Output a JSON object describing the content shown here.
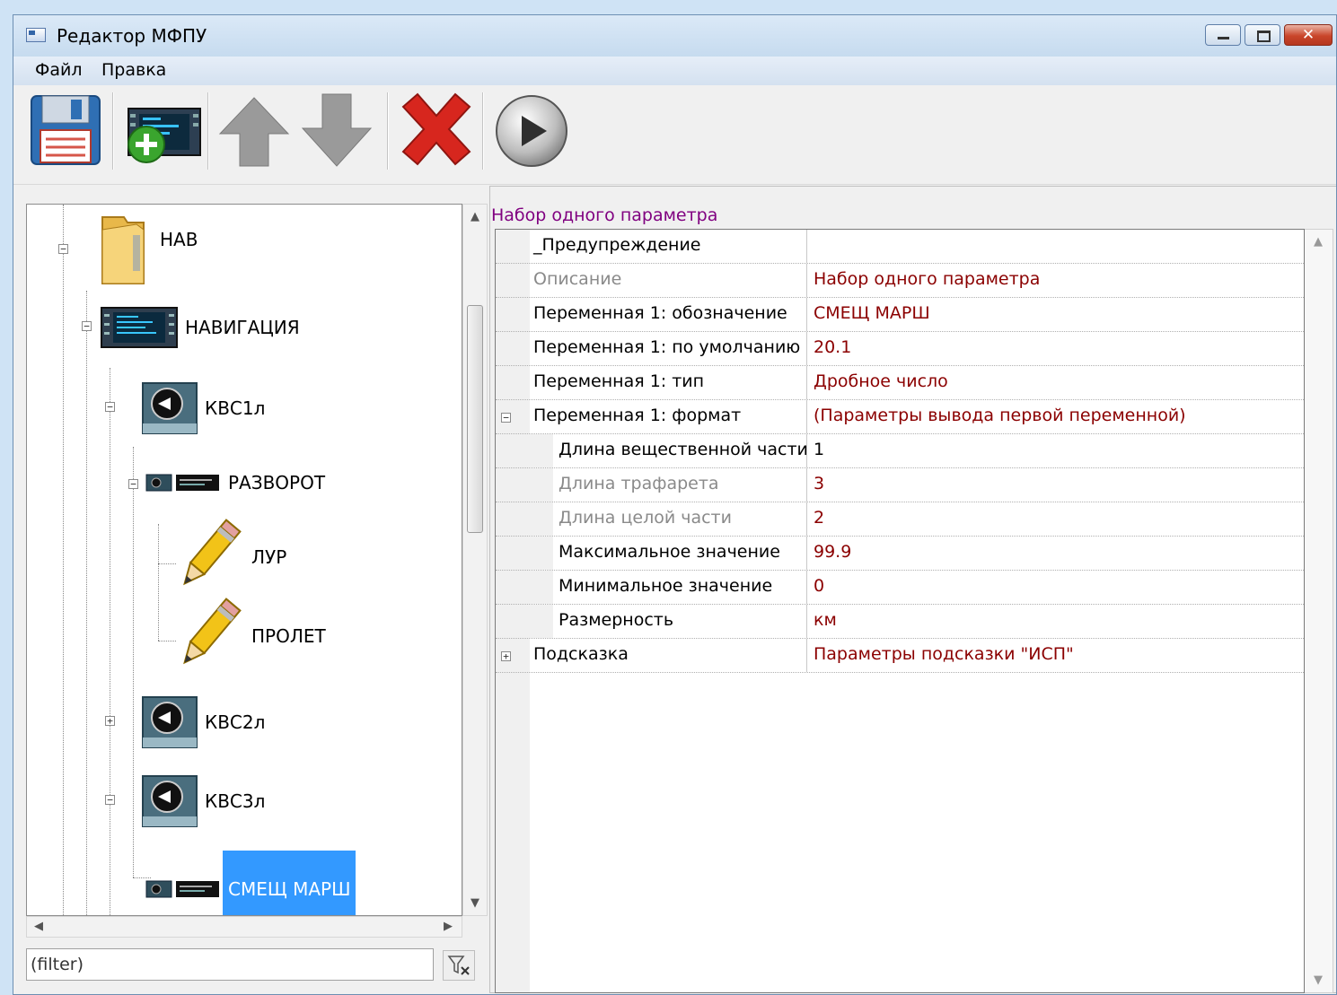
{
  "window": {
    "title": "Редактор МФПУ"
  },
  "menu": {
    "file": "Файл",
    "edit": "Правка"
  },
  "toolbar": {
    "buttons": [
      "save-icon",
      "add-panel-icon",
      "arrow-up-icon",
      "arrow-down-icon",
      "delete-icon",
      "play-icon"
    ]
  },
  "tree": {
    "nodes": [
      {
        "label": "НАВ",
        "icon": "folder-icon",
        "expanded": true
      },
      {
        "label": "НАВИГАЦИЯ",
        "icon": "panel-icon",
        "expanded": true
      },
      {
        "label": "КВС1л",
        "icon": "knob-icon",
        "expanded": true
      },
      {
        "label": "РАЗВОРОТ",
        "icon": "device-icon",
        "expanded": true
      },
      {
        "label": "ЛУР",
        "icon": "pencil-icon"
      },
      {
        "label": "ПРОЛЕТ",
        "icon": "pencil-icon"
      },
      {
        "label": "КВС2л",
        "icon": "knob-icon",
        "expanded": false
      },
      {
        "label": "КВС3л",
        "icon": "knob-icon",
        "expanded": true
      },
      {
        "label": "СМЕЩ МАРШ",
        "icon": "device-icon",
        "selected": true
      }
    ],
    "filter_placeholder": "(filter)"
  },
  "properties": {
    "caption": "Набор одного параметра",
    "rows": [
      {
        "name": "_Предупреждение",
        "value": "",
        "readonly": false
      },
      {
        "name": "Описание",
        "value": "Набор одного параметра",
        "readonly": true
      },
      {
        "name": "Переменная 1: обозначение",
        "value": "СМЕЩ МАРШ",
        "readonly": false
      },
      {
        "name": "Переменная 1: по умолчанию",
        "value": "20.1",
        "readonly": false
      },
      {
        "name": "Переменная 1: тип",
        "value": "Дробное число",
        "readonly": false
      },
      {
        "name": "Переменная 1: формат",
        "value": "(Параметры вывода первой переменной)",
        "readonly": false,
        "expandable": "expanded"
      },
      {
        "name": "Длина вещественной части",
        "value": "1",
        "readonly": false,
        "child": true
      },
      {
        "name": "Длина трафарета",
        "value": "3",
        "readonly": true,
        "child": true
      },
      {
        "name": "Длина целой части",
        "value": "2",
        "readonly": true,
        "child": true
      },
      {
        "name": "Максимальное значение",
        "value": "99.9",
        "readonly": false,
        "child": true
      },
      {
        "name": "Минимальное значение",
        "value": "0",
        "readonly": false,
        "child": true
      },
      {
        "name": "Размерность",
        "value": "км",
        "readonly": false,
        "child": true
      },
      {
        "name": "Подсказка",
        "value": "Параметры подсказки \"ИСП\"",
        "readonly": false,
        "expandable": "collapsed"
      }
    ]
  },
  "colors": {
    "selection": "#3399ff",
    "value_text": "#8b0000",
    "caption_text": "#800080"
  }
}
